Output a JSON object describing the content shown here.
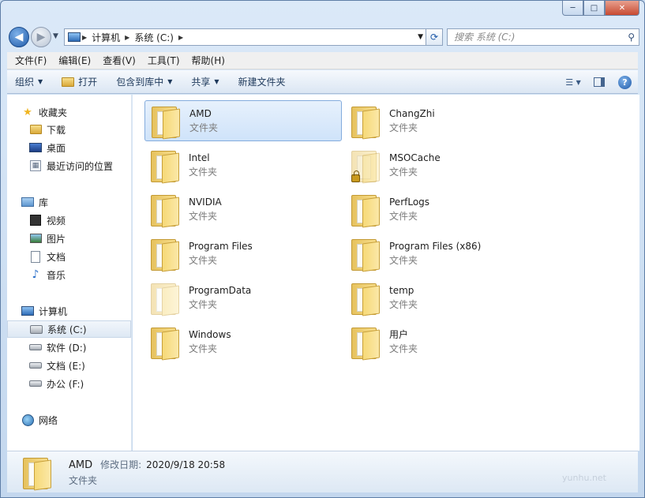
{
  "window": {
    "minimize": "─",
    "maximize": "□",
    "close": "✕"
  },
  "address": {
    "crumbs": [
      "计算机",
      "系统 (C:)"
    ],
    "search_placeholder": "搜索 系统 (C:)"
  },
  "menu": [
    "文件(F)",
    "编辑(E)",
    "查看(V)",
    "工具(T)",
    "帮助(H)"
  ],
  "toolbar": {
    "organize": "组织",
    "open": "打开",
    "include_library": "包含到库中",
    "share": "共享",
    "new_folder": "新建文件夹"
  },
  "nav": {
    "favorites": "收藏夹",
    "downloads": "下载",
    "desktop": "桌面",
    "recent": "最近访问的位置",
    "libraries": "库",
    "videos": "视频",
    "pictures": "图片",
    "documents": "文档",
    "music": "音乐",
    "computer": "计算机",
    "drive_c": "系统 (C:)",
    "drive_d": "软件 (D:)",
    "drive_e": "文档 (E:)",
    "drive_f": "办公 (F:)",
    "network": "网络"
  },
  "folders": [
    {
      "name": "AMD",
      "type": "文件夹"
    },
    {
      "name": "ChangZhi",
      "type": "文件夹"
    },
    {
      "name": "Intel",
      "type": "文件夹"
    },
    {
      "name": "MSOCache",
      "type": "文件夹"
    },
    {
      "name": "NVIDIA",
      "type": "文件夹"
    },
    {
      "name": "PerfLogs",
      "type": "文件夹"
    },
    {
      "name": "Program Files",
      "type": "文件夹"
    },
    {
      "name": "Program Files (x86)",
      "type": "文件夹"
    },
    {
      "name": "ProgramData",
      "type": "文件夹"
    },
    {
      "name": "temp",
      "type": "文件夹"
    },
    {
      "name": "Windows",
      "type": "文件夹"
    },
    {
      "name": "用户",
      "type": "文件夹"
    }
  ],
  "details": {
    "name": "AMD",
    "modified_label": "修改日期:",
    "modified_value": "2020/9/18 20:58",
    "type": "文件夹"
  },
  "watermark": "yunhu.net"
}
